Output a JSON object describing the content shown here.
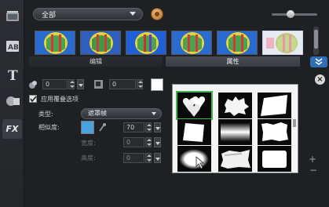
{
  "top": {
    "category_label": "全部"
  },
  "tabs": {
    "edit": "编辑",
    "attributes": "属性"
  },
  "controls": {
    "border_width_value": "0",
    "shadow_value": "0",
    "apply_overlay_label": "应用覆叠选项",
    "apply_overlay_checked": true,
    "type_label": "类型:",
    "type_value": "遮罩帧",
    "similarity_label": "相似度:",
    "similarity_value": "70",
    "width_label": "宽度:",
    "width_value": "0",
    "height_label": "高度:",
    "height_value": "0"
  },
  "colors": {
    "accent_blue": "#2f6fb8",
    "selection_green": "#3fb34f",
    "swatch_blue": "#4aa3e0",
    "swatch_white": "#ffffff"
  },
  "icons": {
    "left_tools": [
      "filmstrip-icon",
      "title-ab-icon",
      "text-t-icon",
      "graphics-icon",
      "fx-icon"
    ],
    "gallery_side": [
      "add-icon",
      "remove-icon"
    ]
  }
}
